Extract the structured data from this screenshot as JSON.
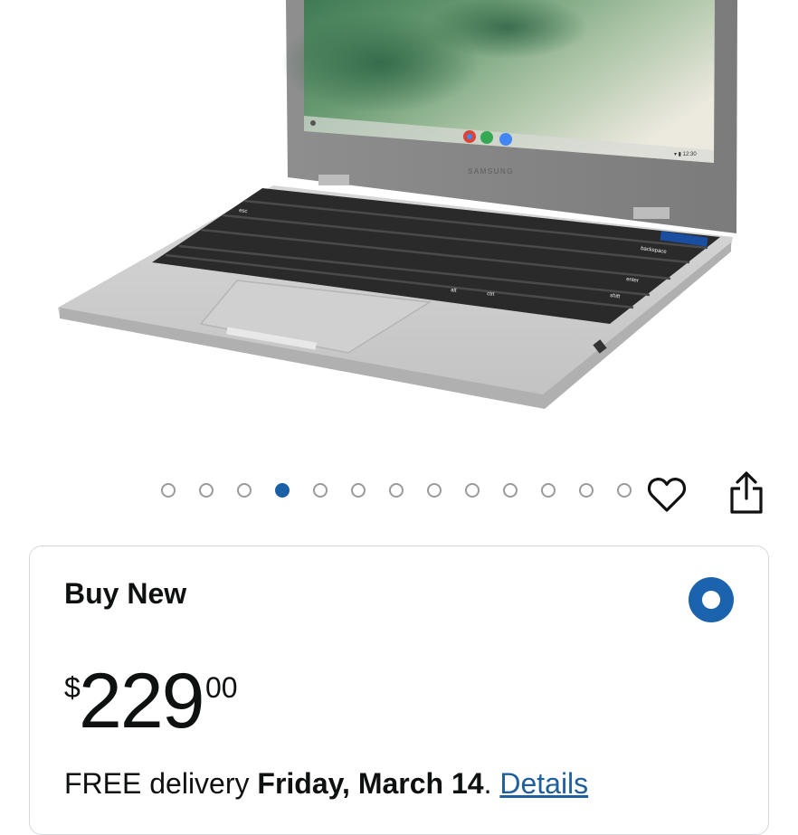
{
  "product": {
    "image_label": "Samsung Chromebook 4 laptop",
    "screen_brand": "SAMSUNG",
    "keyboard_labels": [
      "backspace",
      "enter",
      "shift",
      "ctrl",
      "alt",
      "esc"
    ]
  },
  "carousel": {
    "dot_count": 13,
    "active_index": 3
  },
  "actions": {
    "heart_icon": "heart-outline-icon",
    "share_icon": "share-icon"
  },
  "buy_box": {
    "title": "Buy New",
    "selected": true,
    "price": {
      "symbol": "$",
      "whole": "229",
      "fraction": "00"
    },
    "delivery": {
      "prefix": "FREE delivery ",
      "date": "Friday, March 14",
      "suffix": ". ",
      "details_link": "Details"
    }
  },
  "colors": {
    "accent_blue": "#1b64ad",
    "link_blue": "#1f5f9e",
    "inactive_dot": "#9a9a9a",
    "card_border": "#d5d9d9"
  }
}
